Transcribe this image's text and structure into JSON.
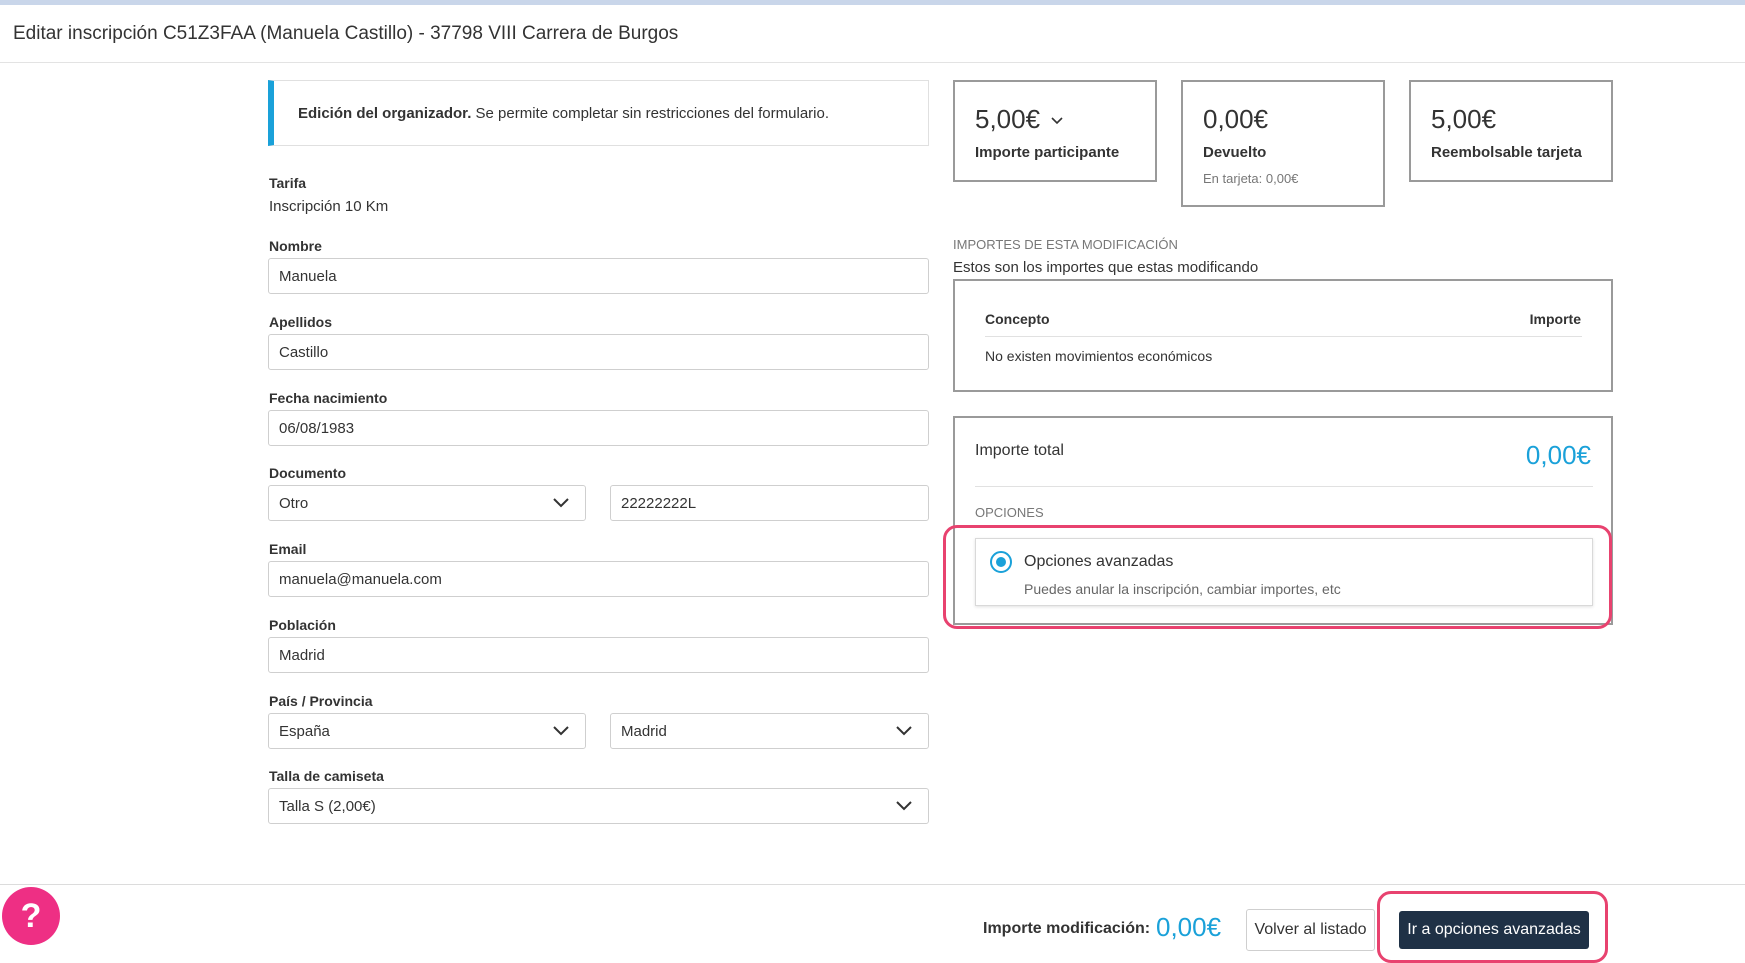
{
  "header": {
    "title": "Editar inscripción C51Z3FAA (Manuela Castillo) - 37798 VIII Carrera de Burgos"
  },
  "notice": {
    "bold": "Edición del organizador.",
    "text": " Se permite completar sin restricciones del formulario."
  },
  "form": {
    "tarifa": {
      "label": "Tarifa",
      "value": "Inscripción 10 Km"
    },
    "nombre": {
      "label": "Nombre",
      "value": "Manuela"
    },
    "apellidos": {
      "label": "Apellidos",
      "value": "Castillo"
    },
    "fecha": {
      "label": "Fecha nacimiento",
      "value": "06/08/1983"
    },
    "documento": {
      "label": "Documento",
      "type": "Otro",
      "number": "22222222L"
    },
    "email": {
      "label": "Email",
      "value": "manuela@manuela.com"
    },
    "poblacion": {
      "label": "Población",
      "value": "Madrid"
    },
    "pais": {
      "label": "País / Provincia",
      "country": "España",
      "province": "Madrid"
    },
    "talla": {
      "label": "Talla de camiseta",
      "value": "Talla S (2,00€)"
    }
  },
  "summary": {
    "cards": [
      {
        "amount": "5,00€",
        "label": "Importe participante"
      },
      {
        "amount": "0,00€",
        "label": "Devuelto",
        "sub": "En tarjeta: 0,00€"
      },
      {
        "amount": "5,00€",
        "label": "Reembolsable tarjeta"
      }
    ]
  },
  "modifications": {
    "title": "IMPORTES DE ESTA MODIFICACIÓN",
    "desc": "Estos son los importes que estas modificando",
    "col_concept": "Concepto",
    "col_amount": "Importe",
    "empty": "No existen movimientos económicos"
  },
  "total": {
    "label": "Importe total",
    "amount": "0,00€",
    "options_title": "OPCIONES",
    "option": {
      "title": "Opciones avanzadas",
      "desc": "Puedes anular la inscripción, cambiar importes, etc",
      "selected": true
    }
  },
  "footer": {
    "help": "?",
    "label": "Importe modificación:",
    "amount": "0,00€",
    "back": "Volver al listado",
    "primary": "Ir a opciones avanzadas"
  },
  "colors": {
    "accent": "#1aa1d9",
    "highlight": "#e8426f",
    "help": "#ee2f84",
    "primary": "#1f3146"
  }
}
